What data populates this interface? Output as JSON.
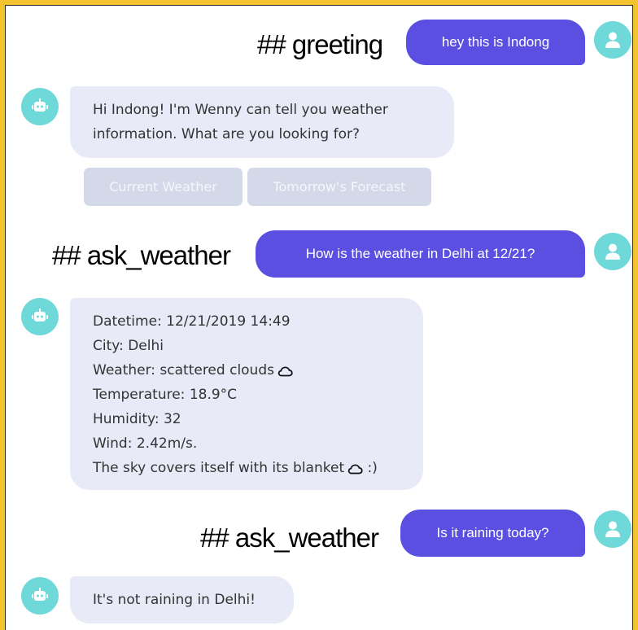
{
  "colors": {
    "frame_border": "#f4c430",
    "avatar_bg": "#6fd8d8",
    "user_bubble": "#5a4fe0",
    "bot_bubble": "#e8ebf7",
    "quick_reply_bg": "#d3d9e8"
  },
  "icons": {
    "user_avatar": "user-silhouette-icon",
    "bot_avatar": "robot-icon",
    "weather": "cloud-icon"
  },
  "annotations": {
    "greeting": "## greeting",
    "ask_weather_1": "## ask_weather",
    "ask_weather_2": "## ask_weather"
  },
  "messages": {
    "user_1": "hey this is Indong",
    "bot_1": {
      "line1": "Hi Indong! I'm Wenny can tell you weather",
      "line2": "information. What are you looking for?"
    },
    "quick_replies": [
      "Current Weather",
      "Tomorrow's Forecast"
    ],
    "user_2": "How is the weather in Delhi at 12/21?",
    "bot_2": {
      "datetime": "Datetime: 12/21/2019 14:49",
      "city": "City: Delhi",
      "weather": "Weather: scattered clouds",
      "temperature": "Temperature: 18.9°C",
      "humidity": "Humidity: 32",
      "wind": "Wind: 2.42m/s.",
      "sky": "The sky covers itself with its blanket",
      "sky_suffix": " :)"
    },
    "user_3": "Is it raining today?",
    "bot_3": "It's not raining in Delhi!"
  }
}
